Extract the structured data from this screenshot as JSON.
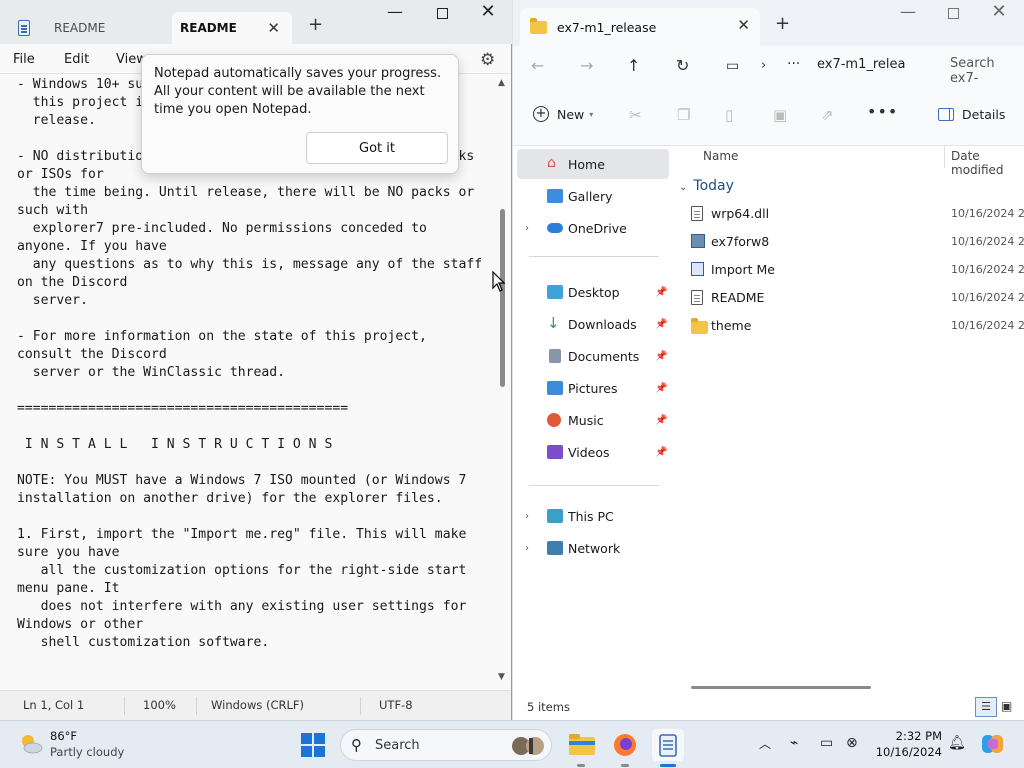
{
  "notepad": {
    "tabs": [
      {
        "label": "README"
      },
      {
        "label": "README"
      }
    ],
    "menu": [
      "File",
      "Edit",
      "View"
    ],
    "lines": [
      "- Windows 10+ support is TBD. Given the state of",
      "  this project i...       ...-centric",
      "  release.",
      "",
      "- NO distribution of this software in transformation packs",
      "or ISOs for",
      "  the time being. Until release, there will be NO packs or",
      "such with",
      "  explorer7 pre-included. No permissions conceded to",
      "anyone. If you have",
      "  any questions as to why this is, message any of the staff",
      "on the Discord",
      "  server.",
      "",
      "- For more information on the state of this project,",
      "consult the Discord",
      "  server or the WinClassic thread.",
      "",
      "==========================================",
      "",
      " I N S T A L L   I N S T R U C T I O N S",
      "",
      "NOTE: You MUST have a Windows 7 ISO mounted (or Windows 7",
      "installation on another drive) for the explorer files.",
      "",
      "1. First, import the \"Import me.reg\" file. This will make",
      "sure you have",
      "   all the customization options for the right-side start",
      "menu pane. It",
      "   does not interfere with any existing user settings for",
      "Windows or other",
      "   shell customization software."
    ],
    "toast": {
      "message": "Notepad automatically saves your progress. All your content will be available the next time you open Notepad.",
      "button": "Got it"
    },
    "status": {
      "position": "Ln 1, Col 1",
      "zoom": "100%",
      "line_ending": "Windows (CRLF)",
      "encoding": "UTF-8"
    }
  },
  "explorer": {
    "tab_title": "ex7-m1_release",
    "breadcrumb": "ex7-m1_relea",
    "search_placeholder": "Search ex7-",
    "new_label": "New",
    "details_label": "Details",
    "nav": {
      "home": "Home",
      "gallery": "Gallery",
      "onedrive": "OneDrive",
      "desktop": "Desktop",
      "downloads": "Downloads",
      "documents": "Documents",
      "pictures": "Pictures",
      "music": "Music",
      "videos": "Videos",
      "this_pc": "This PC",
      "network": "Network"
    },
    "columns": {
      "name": "Name",
      "date": "Date modified"
    },
    "group": "Today",
    "files": [
      {
        "name": "wrp64.dll",
        "date": "10/16/2024 2:"
      },
      {
        "name": "ex7forw8",
        "date": "10/16/2024 2:"
      },
      {
        "name": "Import Me",
        "date": "10/16/2024 2:"
      },
      {
        "name": "README",
        "date": "10/16/2024 2:"
      },
      {
        "name": "theme",
        "date": "10/16/2024 2:"
      }
    ],
    "item_count": "5 items"
  },
  "taskbar": {
    "weather_temp": "86°F",
    "weather_desc": "Partly cloudy",
    "search_label": "Search",
    "time": "2:32 PM",
    "date": "10/16/2024"
  },
  "colors": {
    "accent": "#1b74d8",
    "folder": "#f4c544"
  }
}
